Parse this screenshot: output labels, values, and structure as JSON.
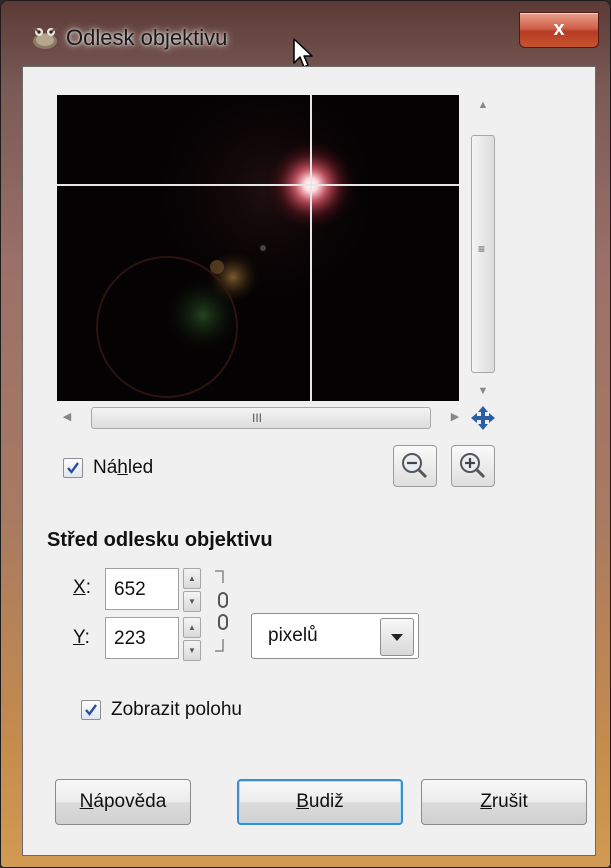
{
  "window": {
    "title": "Odlesk objektivu",
    "close_label": "x"
  },
  "preview": {
    "checkbox_label_pre": "Ná",
    "checkbox_label_ul": "h",
    "checkbox_label_post": "led",
    "checked": true,
    "hscroll_grip": "III",
    "vscroll_grip": "≡"
  },
  "center": {
    "section_title": "Střed odlesku objektivu",
    "x_label_ul": "X",
    "x_label_post": ":",
    "x_value": "652",
    "y_label_ul": "Y",
    "y_label_post": ":",
    "y_value": "223",
    "unit_value": "pixelů",
    "show_position_label": "Zobrazit polohu",
    "show_position_checked": true
  },
  "buttons": {
    "help_ul": "N",
    "help_post": "ápověda",
    "ok_ul": "B",
    "ok_post": "udiž",
    "cancel_ul": "Z",
    "cancel_post": "rušit"
  },
  "colors": {
    "accent": "#3c8ccf",
    "close_red": "#c9452c"
  }
}
